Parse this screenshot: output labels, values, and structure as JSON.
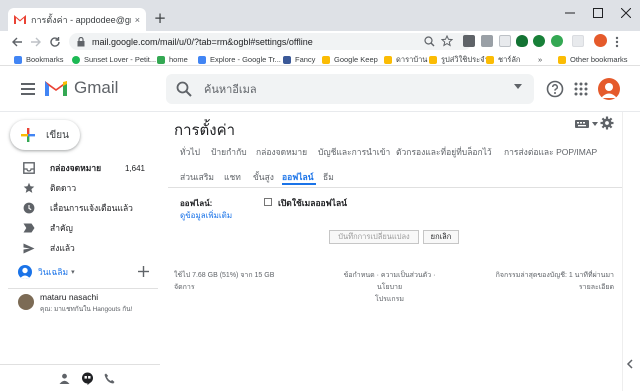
{
  "browser": {
    "tab_title": "การตั้งค่า - appdodee@gmail.com",
    "tab_close": "×",
    "new_tab": "+",
    "url": "mail.google.com/mail/u/0/?tab=rm&ogbl#settings/offline",
    "bookmarks": [
      {
        "label": "Bookmarks",
        "color": "#4285f4"
      },
      {
        "label": "Sunset Lover - Petit...",
        "color": "#1db954"
      },
      {
        "label": "home",
        "color": "#34a853"
      },
      {
        "label": "Explore - Google Tr...",
        "color": "#4285f4"
      },
      {
        "label": "Fancy",
        "color": "#3b5998"
      },
      {
        "label": "Google Keep",
        "color": "#fbbc04"
      },
      {
        "label": "ดาราบ้าน",
        "color": "#fbbc04"
      },
      {
        "label": "รูปส่วิใชิประจำ",
        "color": "#fbbc04"
      },
      {
        "label": "ชาร์ลัก",
        "color": "#fbbc04"
      },
      {
        "label": "»",
        "color": ""
      },
      {
        "label": "Other bookmarks",
        "color": "#fbbc04"
      }
    ]
  },
  "header": {
    "brand": "Gmail",
    "search_placeholder": "ค้นหาอีเมล"
  },
  "leftnav": {
    "compose_label": "เขียน",
    "items": [
      {
        "label": "กล่องจดหมาย",
        "count": "1,641",
        "icon": "inbox-icon",
        "bold": true
      },
      {
        "label": "ติดดาว",
        "count": "",
        "icon": "star-icon",
        "bold": false
      },
      {
        "label": "เลื่อนการแจ้งเตือนแล้ว",
        "count": "",
        "icon": "clock-icon",
        "bold": false
      },
      {
        "label": "สำคัญ",
        "count": "",
        "icon": "important-icon",
        "bold": false
      },
      {
        "label": "ส่งแล้ว",
        "count": "",
        "icon": "send-icon",
        "bold": false
      }
    ],
    "hangouts_user": "วินเฉลิม",
    "hangouts_caret": "▾",
    "contact_name": "mataru nasachi",
    "contact_status": "คุณ: มาแชทกันใน Hangouts กัน!"
  },
  "settings": {
    "title": "การตั้งค่า",
    "tabs_row1": [
      "ทั่วไป",
      "ป้ายกำกับ",
      "กล่องจดหมาย",
      "บัญชีและการนำเข้า",
      "ตัวกรองและที่อยู่ที่บล็อกไว้",
      "การส่งต่อและ POP/IMAP"
    ],
    "tabs_row2": [
      "ส่วนเสริม",
      "แชท",
      "ขั้นสูง",
      "ออฟไลน์",
      "ธีม"
    ],
    "active_tab": "ออฟไลน์",
    "offline_label": "ออฟไลน์:",
    "offline_more_link": "ดูข้อมูลเพิ่มเติม",
    "offline_checkbox_label": "เปิดใช้เมลออฟไลน์",
    "offline_checkbox_checked": false,
    "save_button": "บันทึกการเปลี่ยนแปลง",
    "cancel_button": "ยกเลิก",
    "footer_storage_line1": "ใช้ไป 7.68 GB (51%) จาก 15 GB",
    "footer_storage_line2": "จัดการ",
    "footer_terms_line1": "ข้อกำหนด · ความเป็นส่วนตัว · นโยบาย",
    "footer_terms_line2": "โปรแกรม",
    "footer_activity_line1": "กิจกรรมล่าสุดของบัญชี: 1 นาทีที่ผ่านมา",
    "footer_activity_line2": "รายละเอียด"
  },
  "colors": {
    "accent": "#1a73e8",
    "gmail_red": "#ea4335",
    "avatar": "#e55a2b"
  }
}
